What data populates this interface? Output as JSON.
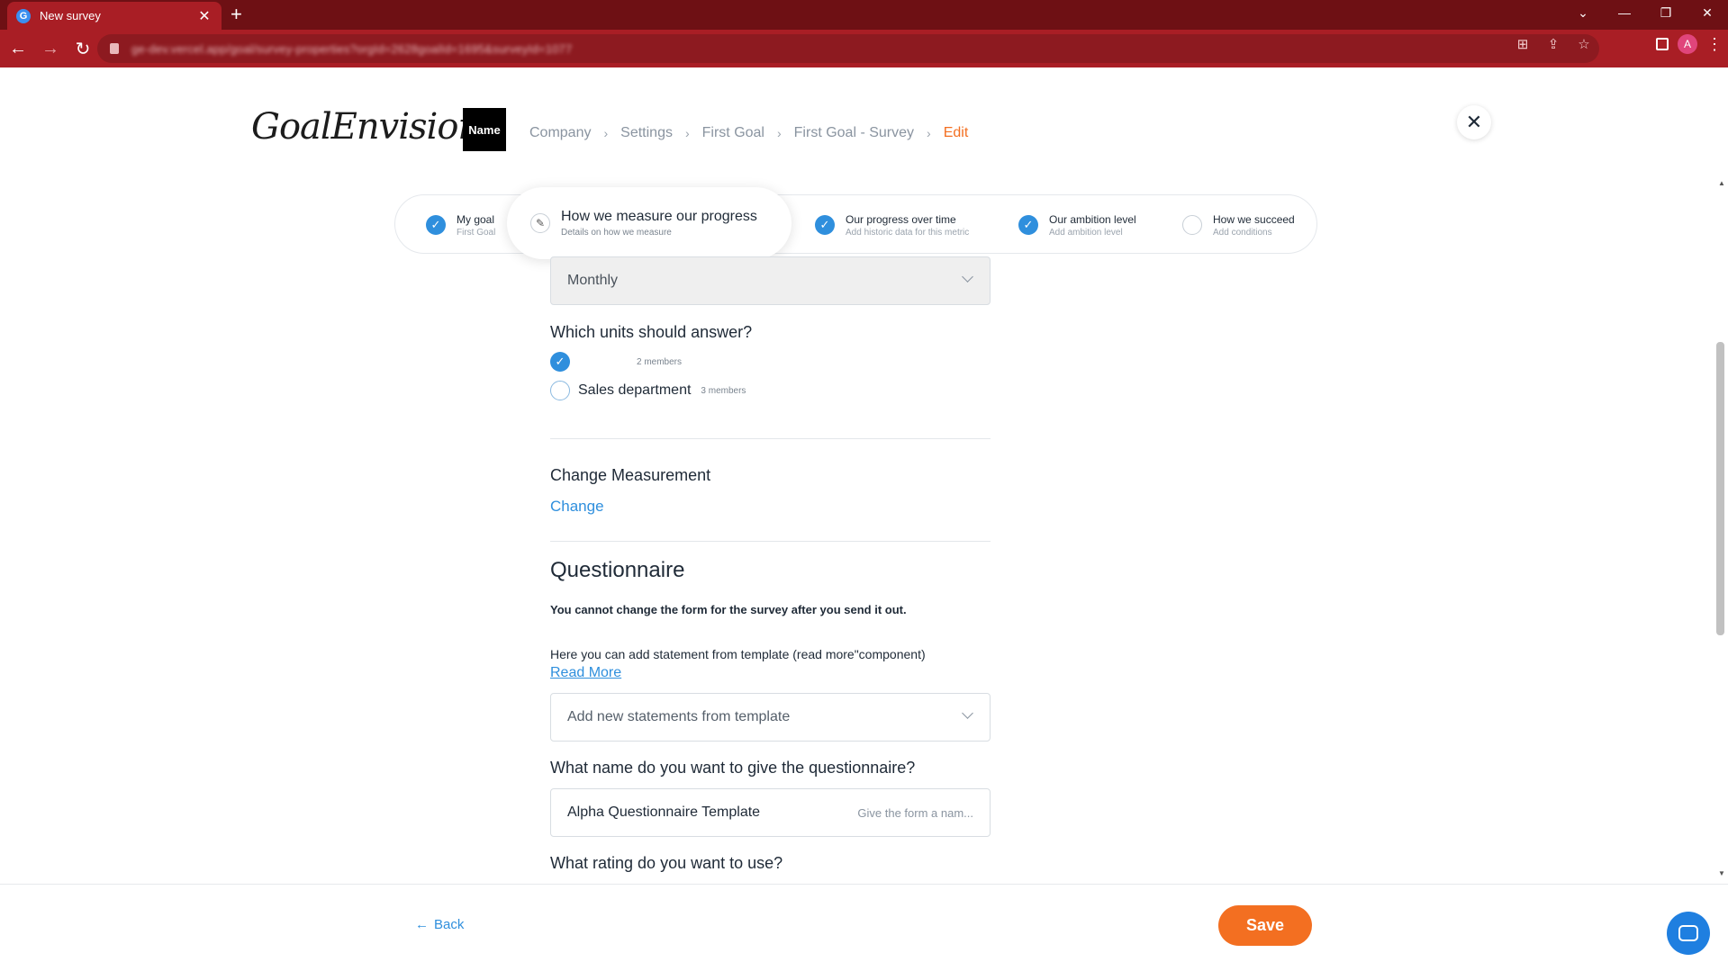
{
  "browser": {
    "tab_title": "New survey",
    "url": "ge-dev.vercel.app/goal/survey-properties?orgId=2628goalId=1695&surveyId=1077",
    "avatar_letter": "A"
  },
  "header": {
    "logo_text": "GoalEnvision",
    "badge_text": "Name",
    "breadcrumb": [
      "Company",
      "Settings",
      "First Goal",
      "First Goal - Survey",
      "Edit"
    ]
  },
  "stepper": {
    "steps": [
      {
        "title": "My goal",
        "subtitle": "First Goal",
        "state": "done"
      },
      {
        "title": "How we measure our progress",
        "subtitle": "Details on how we measure",
        "state": "active"
      },
      {
        "title": "Our progress over time",
        "subtitle": "Add historic data for this metric",
        "state": "done"
      },
      {
        "title": "Our ambition level",
        "subtitle": "Add ambition level",
        "state": "done"
      },
      {
        "title": "How we succeed",
        "subtitle": "Add conditions",
        "state": "todo"
      }
    ]
  },
  "form": {
    "frequency_value": "Monthly",
    "units_label": "Which units should answer?",
    "units": [
      {
        "name": "",
        "members": "2 members",
        "checked": true
      },
      {
        "name": "Sales department",
        "members": "3 members",
        "checked": false
      }
    ],
    "change_measurement_label": "Change Measurement",
    "change_link": "Change",
    "questionnaire_title": "Questionnaire",
    "warning_text": "You cannot change the form for the survey after you send it out.",
    "helper_text": "Here you can add statement from template (read more\"component)",
    "read_more": "Read More",
    "template_placeholder": "Add new statements from template",
    "name_label": "What name do you want to give the questionnaire?",
    "name_value": "Alpha Questionnaire Template",
    "name_placeholder": "Give the form a nam...",
    "rating_label": "What rating do you want to use?"
  },
  "footer": {
    "back_label": "Back",
    "save_label": "Save"
  },
  "colors": {
    "accent_orange": "#f36f21",
    "accent_blue": "#2f8fdd",
    "browser_red": "#a91e25"
  }
}
